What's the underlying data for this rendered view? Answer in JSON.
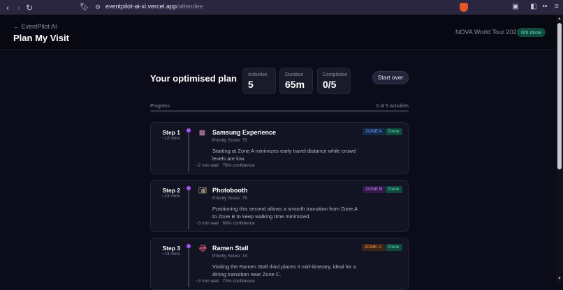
{
  "browser": {
    "url_host": "eventpilot-ai-xi.vercel.app",
    "url_path": "/attendee",
    "back_icon": "arrow-left",
    "forward_icon": "arrow-right",
    "reload_icon": "reload",
    "bookmark_icon": "bookmark",
    "shield_color": "#e2572b"
  },
  "header": {
    "back_link": "← EventPilot AI",
    "title": "Plan My Visit",
    "event_name": "NOVA World Tour 2026",
    "done_badge": "0/5 done"
  },
  "plan": {
    "title": "Your optimised plan",
    "stats": [
      {
        "label": "Activities",
        "value": "5"
      },
      {
        "label": "Duration",
        "value": "65m"
      },
      {
        "label": "Completion",
        "value": "0/5"
      }
    ],
    "start_over": "Start over",
    "progress_label": "Progress",
    "progress_count": "0 of 5 activities",
    "progress_fraction": 0.0
  },
  "steps": [
    {
      "step": "Step 1",
      "duration": "~12 mins",
      "icon": "building-icon",
      "name": "Samsung Experience",
      "score": "Priority Score: 75",
      "description": "Starting at Zone A minimizes early travel distance while crowd levels are low.",
      "wait": "~2 min wait",
      "confidence": "78% confidence",
      "zone": "ZONE A",
      "zone_bg": "#16284a",
      "zone_fg": "#6aa7ff",
      "status": "Done"
    },
    {
      "step": "Step 2",
      "duration": "~13 mins",
      "icon": "camera-icon",
      "name": "Photobooth",
      "score": "Priority Score: 75",
      "description": "Positioning this second allows a smooth transition from Zone A to Zone B to keep walking time minimized.",
      "wait": "~3 min wait",
      "confidence": "69% confidence",
      "zone": "ZONE B",
      "zone_bg": "#33194a",
      "zone_fg": "#c084fc",
      "status": "Done"
    },
    {
      "step": "Step 3",
      "duration": "~13 mins",
      "icon": "ramen-icon",
      "name": "Ramen Stall",
      "score": "Priority Score: 74",
      "description": "Visiting the Ramen Stall third places it mid-itinerary, ideal for a dining transition near Zone C.",
      "wait": "~3 min wait",
      "confidence": "70% confidence",
      "zone": "ZONE C",
      "zone_bg": "#3e2414",
      "zone_fg": "#f59e57",
      "status": "Done"
    }
  ]
}
